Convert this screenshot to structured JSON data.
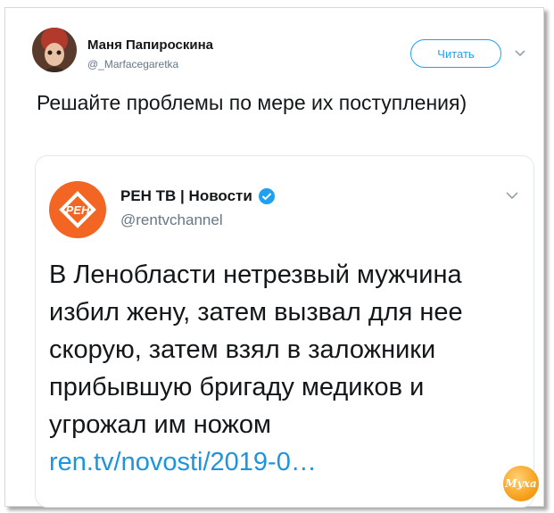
{
  "tweet": {
    "author_name": "Маня Папироскина",
    "author_handle": "@_Marfacegaretka",
    "follow_label": "Читать",
    "text": "Решайте проблемы по мере их поступления)"
  },
  "quoted": {
    "author_name": "РЕН ТВ | Новости",
    "author_handle": "@rentvchannel",
    "logo_text": "РЕН",
    "text": "В Ленобласти нетрезвый мужчина избил жену, затем вызвал для нее скорую, затем взял в заложники прибывшую бригаду медиков и угрожал им ножом",
    "link": "ren.tv/novosti/2019-0…"
  },
  "watermark": "Муха",
  "colors": {
    "accent": "#1da1f2",
    "link": "#1b95e0",
    "brand_orange": "#f26522",
    "text": "#14171a",
    "secondary": "#657786"
  },
  "icons": [
    "chevron-down-icon",
    "verified-badge-icon"
  ]
}
